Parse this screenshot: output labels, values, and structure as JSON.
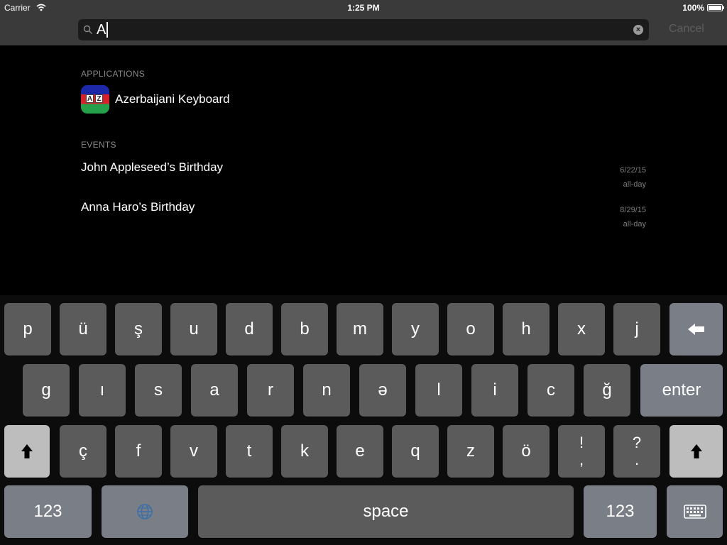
{
  "status_bar": {
    "carrier": "Carrier",
    "time": "1:25 PM",
    "battery": "100%"
  },
  "search": {
    "query": "A",
    "cancel_label": "Cancel"
  },
  "results": {
    "applications_header": "APPLICATIONS",
    "applications": [
      {
        "name": "Azerbaijani Keyboard",
        "icon_letters": [
          "A",
          "Z"
        ]
      }
    ],
    "events_header": "EVENTS",
    "events": [
      {
        "title": "John Appleseed’s Birthday",
        "date": "6/22/15",
        "time": "all-day"
      },
      {
        "title": "Anna Haro’s Birthday",
        "date": "8/29/15",
        "time": "all-day"
      }
    ]
  },
  "keyboard": {
    "row1": [
      "p",
      "ü",
      "ş",
      "u",
      "d",
      "b",
      "m",
      "y",
      "o",
      "h",
      "x",
      "j"
    ],
    "row2": [
      "g",
      "ı",
      "s",
      "a",
      "r",
      "n",
      "ə",
      "l",
      "i",
      "c",
      "ğ"
    ],
    "row3": [
      "ç",
      "f",
      "v",
      "t",
      "k",
      "e",
      "q",
      "z",
      "ö"
    ],
    "punct1": {
      "top": "!",
      "bottom": ","
    },
    "punct2": {
      "top": "?",
      "bottom": "."
    },
    "enter_label": "enter",
    "numbers_label": "123",
    "space_label": "space"
  },
  "colors": {
    "key": "#5b5b5b",
    "function_key": "#7a7e86",
    "shift_key": "#bdbdbd",
    "header": "#3a3a3a"
  }
}
